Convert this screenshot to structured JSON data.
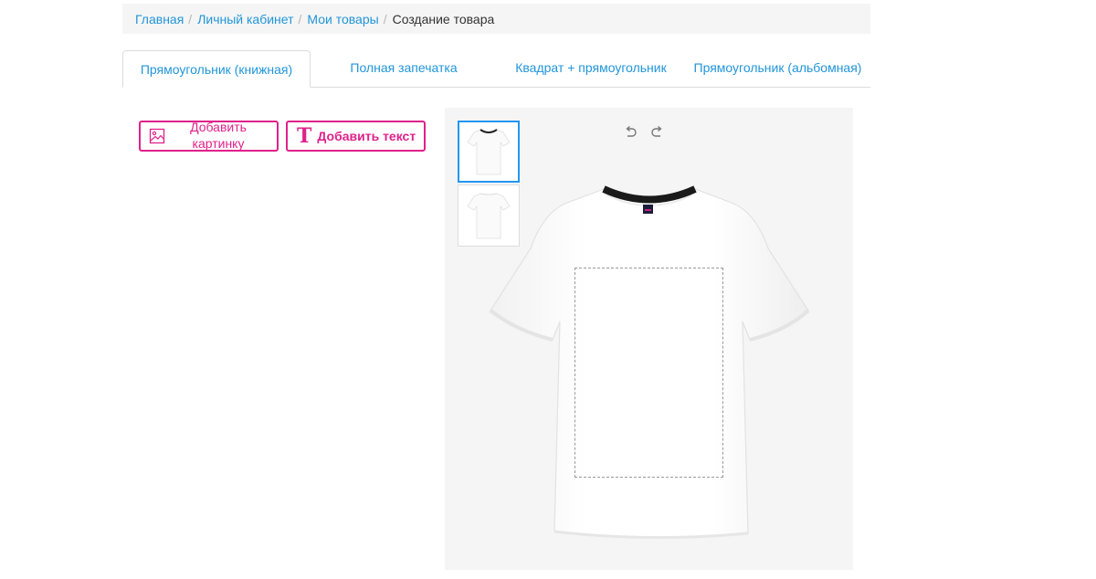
{
  "breadcrumb": {
    "items": [
      "Главная",
      "Личный кабинет",
      "Мои товары"
    ],
    "separator": "/",
    "current": "Создание товара"
  },
  "tabs": [
    {
      "label": "Прямоугольник (книжная)",
      "active": true
    },
    {
      "label": "Полная запечатка",
      "active": false
    },
    {
      "label": "Квадрат + прямоугольник",
      "active": false
    },
    {
      "label": "Прямоугольник (альбомная)",
      "active": false
    }
  ],
  "toolbar": {
    "add_image_label": "Добавить картинку",
    "add_image_icon": "image-icon",
    "add_text_label": "Добавить текст",
    "add_text_icon": "text-T-icon",
    "accent_color": "#e0218a"
  },
  "editor": {
    "undo_icon": "undo-icon",
    "redo_icon": "redo-icon",
    "product": "t-shirt",
    "views": [
      {
        "name": "front",
        "selected": true
      },
      {
        "name": "back",
        "selected": false
      }
    ]
  },
  "colors": {
    "link": "#2196d8",
    "selected_border": "#2196f3",
    "canvas_bg": "#f5f5f5"
  }
}
